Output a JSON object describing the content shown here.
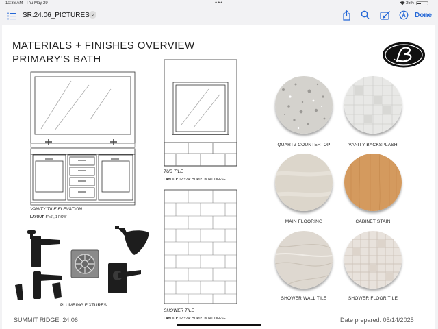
{
  "status": {
    "time": "10:36 AM",
    "date": "Thu May 29",
    "dots": "•••",
    "battery": "35%"
  },
  "toolbar": {
    "title": "SR.24.06_PICTURES",
    "chevron": "⌄",
    "done": "Done"
  },
  "document": {
    "title_line1": "MATERIALS + FINISHES OVERVIEW",
    "title_line2": "PRIMARY'S BATH",
    "vanity_caption": "VANITY TILE ELEVATION",
    "vanity_layout_key": "LAYOUT:",
    "vanity_layout_val": " 5\"x5\", 1 ROW",
    "tub_caption": "TUB TILE",
    "tub_layout_key": "LAYOUT:",
    "tub_layout_val": " 12\"x24\" HORIZONTAL OFFSET",
    "shower_caption": "SHOWER TILE",
    "shower_layout_key": "LAYOUT:",
    "shower_layout_val": " 12\"x24\" HORIZONTAL OFFSET",
    "plumbing_label": "PLUMBING FIXTURES",
    "swatches": [
      {
        "label": "QUARTZ COUNTERTOP",
        "color": "#d4d2cd"
      },
      {
        "label": "VANITY BACKSPLASH",
        "color": "#e8e8e6"
      },
      {
        "label": "MAIN FLOORING",
        "color": "#dcd6cb"
      },
      {
        "label": "CABINET STAIN",
        "color": "#d49a5e"
      },
      {
        "label": "SHOWER WALL TILE",
        "color": "#ded8d0"
      },
      {
        "label": "SHOWER FLOOR TILE",
        "color": "#e8e2dc"
      }
    ],
    "footer_left": "SUMMIT RIDGE: 24.06",
    "footer_right": "Date prepared: 05/14/2025"
  }
}
